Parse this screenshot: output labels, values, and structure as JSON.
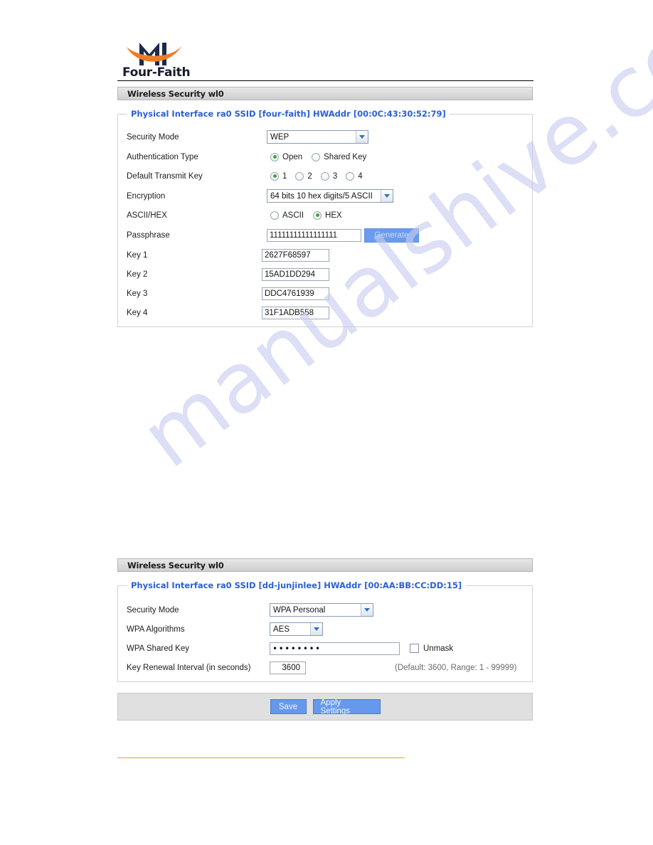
{
  "brand": {
    "name": "Four-Faith",
    "logo_colors": {
      "mark_dark": "#1b2a4a",
      "swoosh_orange": "#f07c22"
    }
  },
  "sections": [
    {
      "title": "Wireless Security wl0",
      "legend": "Physical Interface ra0 SSID [four-faith] HWAddr [00:0C:43:30:52:79]",
      "rows": {
        "security_mode": {
          "label": "Security Mode",
          "value": "WEP"
        },
        "auth_type": {
          "label": "Authentication Type",
          "options": [
            "Open",
            "Shared Key"
          ],
          "selected": "Open"
        },
        "default_transmit_key": {
          "label": "Default Transmit Key",
          "options": [
            "1",
            "2",
            "3",
            "4"
          ],
          "selected": "1"
        },
        "encryption": {
          "label": "Encryption",
          "value": "64 bits 10 hex digits/5 ASCII"
        },
        "ascii_hex": {
          "label": "ASCII/HEX",
          "options": [
            "ASCII",
            "HEX"
          ],
          "selected": "HEX"
        },
        "passphrase": {
          "label": "Passphrase",
          "value": "11111111111111111",
          "button": "Generate"
        },
        "key1": {
          "label": "Key 1",
          "value": "2627F68597"
        },
        "key2": {
          "label": "Key 2",
          "value": "15AD1DD294"
        },
        "key3": {
          "label": "Key 3",
          "value": "DDC4761939"
        },
        "key4": {
          "label": "Key 4",
          "value": "31F1ADB558"
        }
      }
    },
    {
      "title": "Wireless Security wl0",
      "legend": "Physical Interface ra0 SSID [dd-junjinlee] HWAddr [00:AA:BB:CC:DD:15]",
      "rows": {
        "security_mode": {
          "label": "Security Mode",
          "value": "WPA Personal"
        },
        "wpa_algorithms": {
          "label": "WPA Algorithms",
          "value": "AES"
        },
        "wpa_shared_key": {
          "label": "WPA Shared Key",
          "value": "••••••••",
          "unmask_label": "Unmask",
          "unmask_checked": false
        },
        "key_renewal": {
          "label": "Key Renewal Interval (in seconds)",
          "value": "3600",
          "note": "(Default: 3600, Range: 1 - 99999)"
        }
      }
    }
  ],
  "actions": {
    "save": "Save",
    "apply": "Apply Settings"
  },
  "watermark": {
    "text": "manualshive.com"
  }
}
